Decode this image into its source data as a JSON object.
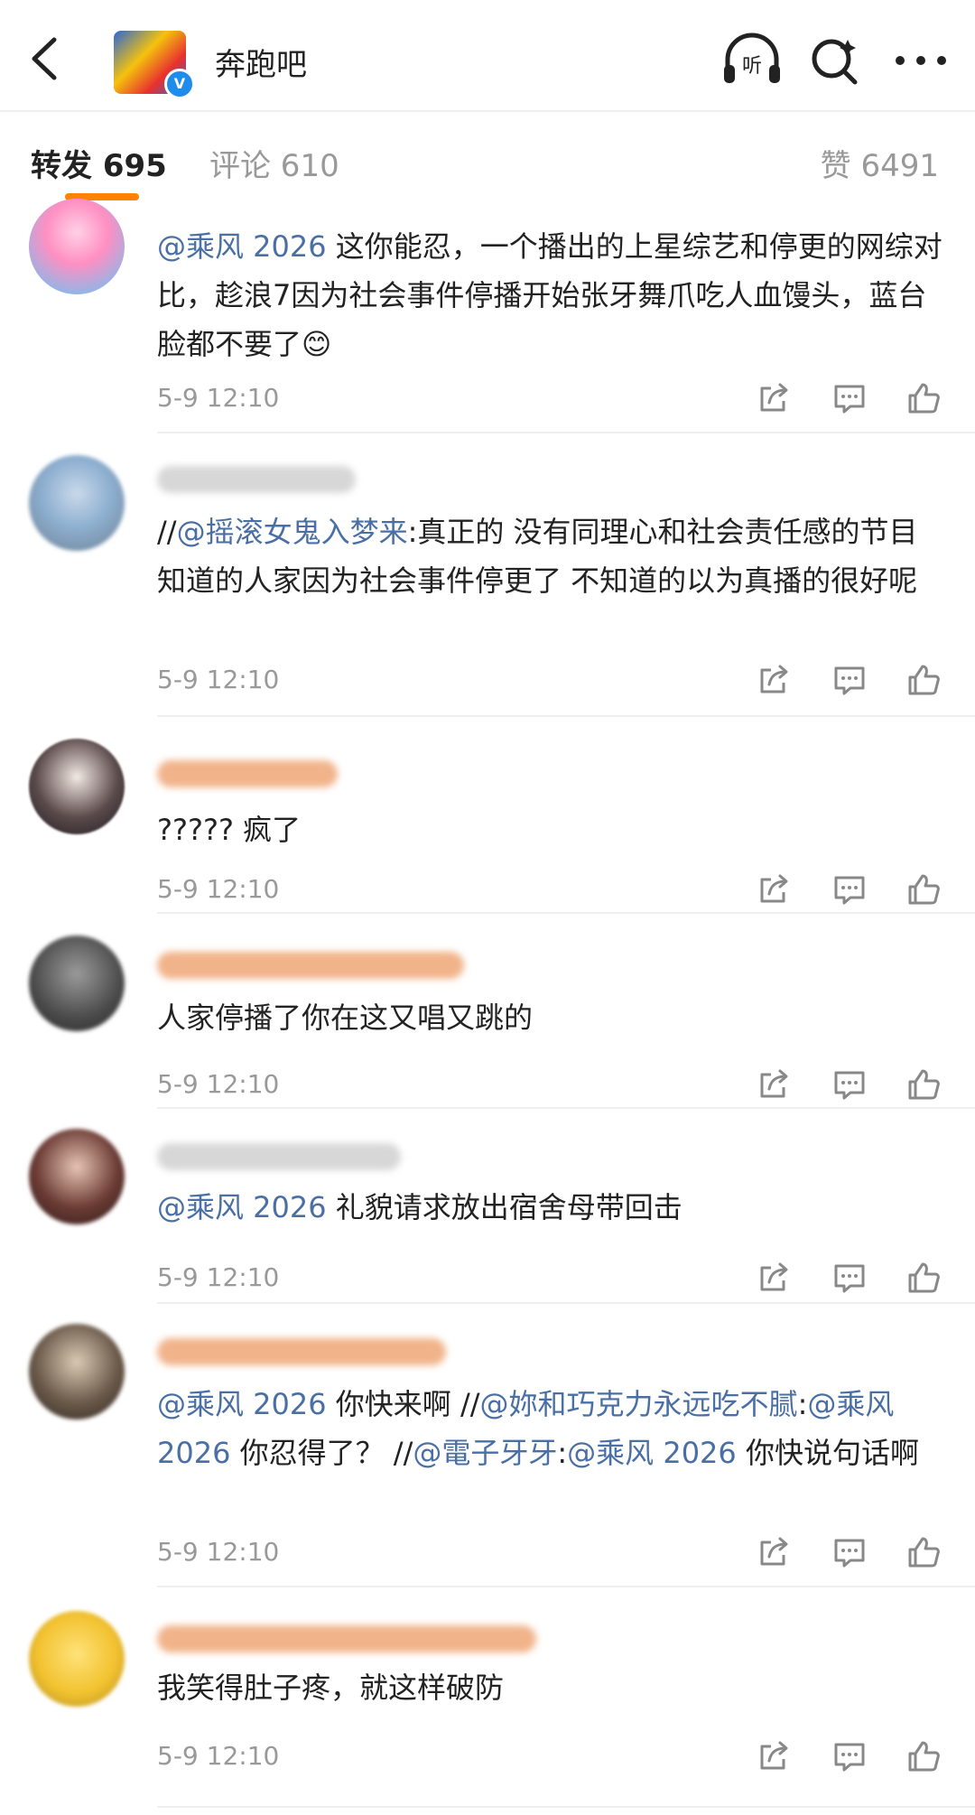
{
  "header": {
    "account_name": "奔跑吧",
    "verified_mark": "V",
    "icons": [
      "back-icon",
      "listen-icon",
      "search-icon",
      "more-icon"
    ]
  },
  "tabs": {
    "repost": "转发 695",
    "comment": "评论 610",
    "like": "赞 6491"
  },
  "colors": {
    "accent": "#ff8200",
    "mention": "#4a6fa5",
    "meta": "#999999"
  },
  "comments": [
    {
      "segments": [
        {
          "t": "@乘风 2026",
          "m": true
        },
        {
          "t": " 这你能忍，一个播出的上星综艺和停更的网综对比，趁浪7因为社会事件停播开始张牙舞爪吃人血馒头，蓝台脸都不要了",
          "m": false
        },
        {
          "t": "😊",
          "m": false
        }
      ],
      "time": "5-9 12:10"
    },
    {
      "segments": [
        {
          "t": "//",
          "m": false
        },
        {
          "t": "@摇滚女鬼入梦来",
          "m": true
        },
        {
          "t": ":真正的 没有同理心和社会责任感的节目 知道的人家因为社会事件停更了 不知道的以为真播的很好呢",
          "m": false
        }
      ],
      "time": "5-9 12:10"
    },
    {
      "segments": [
        {
          "t": "????? 疯了",
          "m": false
        }
      ],
      "time": "5-9 12:10"
    },
    {
      "segments": [
        {
          "t": "人家停播了你在这又唱又跳的",
          "m": false
        }
      ],
      "time": "5-9 12:10"
    },
    {
      "segments": [
        {
          "t": "@乘风 2026",
          "m": true
        },
        {
          "t": " 礼貌请求放出宿舍母带回击",
          "m": false
        }
      ],
      "time": "5-9 12:10"
    },
    {
      "segments": [
        {
          "t": "@乘风 2026",
          "m": true
        },
        {
          "t": " 你快来啊 //",
          "m": false
        },
        {
          "t": "@妳和巧克力永远吃不腻",
          "m": true
        },
        {
          "t": ":",
          "m": false
        },
        {
          "t": "@乘风 2026",
          "m": true
        },
        {
          "t": " 你忍得了？ //",
          "m": false
        },
        {
          "t": "@電子牙牙",
          "m": true
        },
        {
          "t": ":",
          "m": false
        },
        {
          "t": "@乘风 2026",
          "m": true
        },
        {
          "t": " 你快说句话啊",
          "m": false
        }
      ],
      "time": "5-9 12:10"
    },
    {
      "segments": [
        {
          "t": "我笑得肚子疼，就这样破防",
          "m": false
        }
      ],
      "time": "5-9 12:10"
    }
  ]
}
